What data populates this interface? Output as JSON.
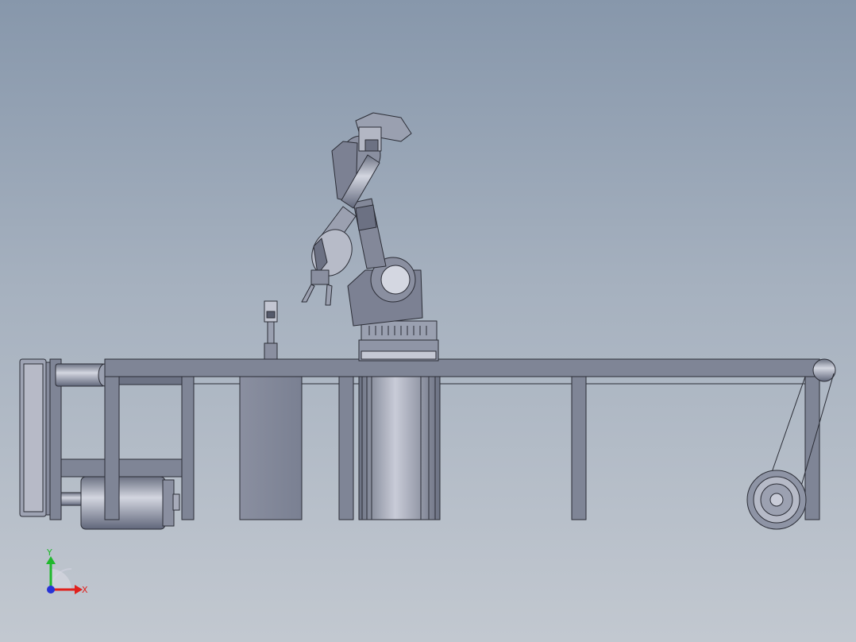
{
  "triad": {
    "x_label": "X",
    "y_label": "Y",
    "x_color": "#e0201c",
    "y_color": "#1fb82c",
    "z_color": "#2733d6"
  },
  "colors": {
    "steel": "#7f8596",
    "steel_dark": "#5b6072",
    "steel_light": "#c7cad6",
    "outline": "#2b2d36",
    "background_top": "#8797ab",
    "background_bottom": "#c2c8d0"
  }
}
